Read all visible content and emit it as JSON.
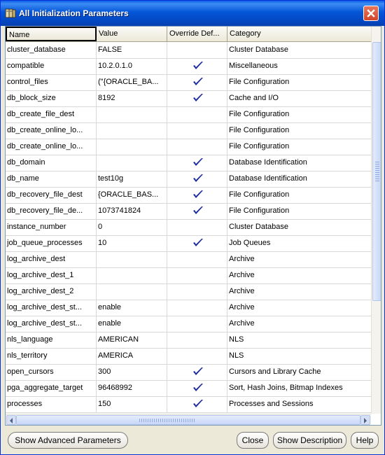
{
  "window": {
    "title": "All Initialization Parameters"
  },
  "table": {
    "columns": [
      "Name",
      "Value",
      "Override Def...",
      "Category"
    ],
    "rows": [
      {
        "name": "cluster_database",
        "value": "FALSE",
        "override": false,
        "category": "Cluster Database"
      },
      {
        "name": "compatible",
        "value": "10.2.0.1.0",
        "override": true,
        "category": "Miscellaneous"
      },
      {
        "name": "control_files",
        "value": "(\"{ORACLE_BA...",
        "override": true,
        "category": "File Configuration"
      },
      {
        "name": "db_block_size",
        "value": "8192",
        "override": true,
        "category": "Cache and I/O"
      },
      {
        "name": "db_create_file_dest",
        "value": "",
        "override": false,
        "category": "File Configuration"
      },
      {
        "name": "db_create_online_lo...",
        "value": "",
        "override": false,
        "category": "File Configuration"
      },
      {
        "name": "db_create_online_lo...",
        "value": "",
        "override": false,
        "category": "File Configuration"
      },
      {
        "name": "db_domain",
        "value": "",
        "override": true,
        "category": "Database Identification"
      },
      {
        "name": "db_name",
        "value": "test10g",
        "override": true,
        "category": "Database Identification"
      },
      {
        "name": "db_recovery_file_dest",
        "value": "{ORACLE_BAS...",
        "override": true,
        "category": "File Configuration"
      },
      {
        "name": "db_recovery_file_de...",
        "value": "1073741824",
        "override": true,
        "category": "File Configuration"
      },
      {
        "name": "instance_number",
        "value": "0",
        "override": false,
        "category": "Cluster Database"
      },
      {
        "name": "job_queue_processes",
        "value": "10",
        "override": true,
        "category": "Job Queues"
      },
      {
        "name": "log_archive_dest",
        "value": "",
        "override": false,
        "category": "Archive"
      },
      {
        "name": "log_archive_dest_1",
        "value": "",
        "override": false,
        "category": "Archive"
      },
      {
        "name": "log_archive_dest_2",
        "value": "",
        "override": false,
        "category": "Archive"
      },
      {
        "name": "log_archive_dest_st...",
        "value": "enable",
        "override": false,
        "category": "Archive"
      },
      {
        "name": "log_archive_dest_st...",
        "value": "enable",
        "override": false,
        "category": "Archive"
      },
      {
        "name": "nls_language",
        "value": "AMERICAN",
        "override": false,
        "category": "NLS"
      },
      {
        "name": "nls_territory",
        "value": "AMERICA",
        "override": false,
        "category": "NLS"
      },
      {
        "name": "open_cursors",
        "value": "300",
        "override": true,
        "category": "Cursors and Library Cache"
      },
      {
        "name": "pga_aggregate_target",
        "value": "96468992",
        "override": true,
        "category": "Sort, Hash Joins, Bitmap Indexes"
      },
      {
        "name": "processes",
        "value": "150",
        "override": true,
        "category": "Processes and Sessions"
      }
    ]
  },
  "buttons": {
    "show_advanced": "Show Advanced Parameters",
    "close": "Close",
    "show_description": "Show Description",
    "help": "Help"
  },
  "colors": {
    "titlebar": "#0556D8",
    "check": "#1B2A9E",
    "background": "#ECE9D8"
  }
}
